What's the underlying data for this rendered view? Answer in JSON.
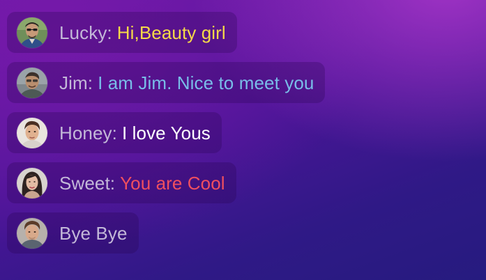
{
  "chat": {
    "messages": [
      {
        "sender": "Lucky",
        "separator": ":",
        "text": "Hi,Beauty girl",
        "text_color": "#f5d948",
        "avatar_icon": "user-avatar-icon"
      },
      {
        "sender": "Jim",
        "separator": ":",
        "text": "I am Jim. Nice to meet you",
        "text_color": "#79bde8",
        "avatar_icon": "user-avatar-icon"
      },
      {
        "sender": "Honey",
        "separator": ":",
        "text": "I love Yous",
        "text_color": "#ffffff",
        "avatar_icon": "user-avatar-icon"
      },
      {
        "sender": "Sweet",
        "separator": ":",
        "text": "You are Cool",
        "text_color": "#ef4f5f",
        "avatar_icon": "user-avatar-icon"
      },
      {
        "sender": "",
        "separator": "",
        "text": "Bye Bye",
        "text_color": "#c3b8d8",
        "avatar_icon": "user-avatar-icon"
      }
    ]
  },
  "colors": {
    "name_color": "#c3b8d8",
    "bubble_bg": "rgba(40,5,80,0.28)"
  }
}
